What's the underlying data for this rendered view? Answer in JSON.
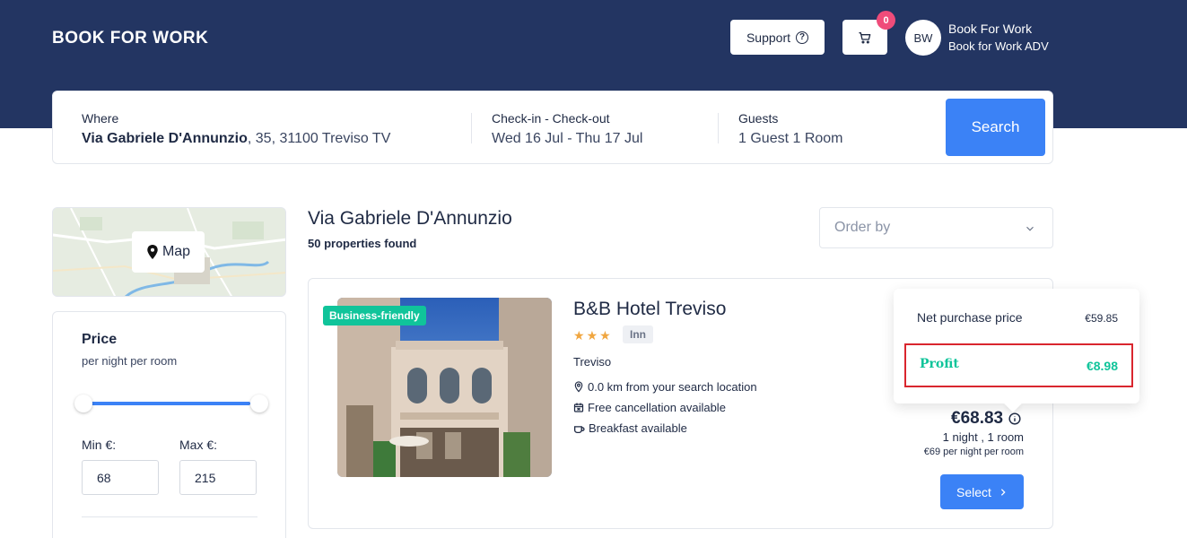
{
  "header": {
    "logo": "BOOK FOR WORK",
    "support_label": "Support",
    "cart_count": "0",
    "avatar_initials": "BW",
    "user_name": "Book For Work",
    "user_company": "Book for Work ADV"
  },
  "search": {
    "where_label": "Where",
    "where_street": "Via Gabriele D'Annunzio",
    "where_rest": ", 35, 31100 Treviso TV",
    "dates_label": "Check-in - Check-out",
    "dates_value": "Wed 16 Jul - Thu 17 Jul",
    "guests_label": "Guests",
    "guests_value": "1 Guest 1 Room",
    "search_label": "Search"
  },
  "sidebar": {
    "map_label": "Map",
    "price_title": "Price",
    "price_sub": "per night per room",
    "min_label": "Min €:",
    "max_label": "Max €:",
    "min_value": "68",
    "max_value": "215"
  },
  "results": {
    "title": "Via Gabriele D'Annunzio",
    "count": "50 properties found",
    "order_placeholder": "Order by"
  },
  "hotel": {
    "badge": "Business-friendly",
    "name": "B&B Hotel Treviso",
    "stars": 3,
    "category": "Inn",
    "city": "Treviso",
    "distance": "0.0 km from your search location",
    "cancellation": "Free cancellation available",
    "breakfast": "Breakfast available",
    "price": "€68.83",
    "stay": "1 night , 1 room",
    "per_night": "€69 per night per room",
    "select_label": "Select"
  },
  "popover": {
    "net_label": "Net purchase price",
    "net_value": "€59.85",
    "profit_label": "Profit",
    "profit_value": "€8.98"
  },
  "colors": {
    "header_bg": "#233562",
    "accent": "#3b82f6",
    "profit": "#10c49a",
    "highlight": "#d9262e"
  }
}
